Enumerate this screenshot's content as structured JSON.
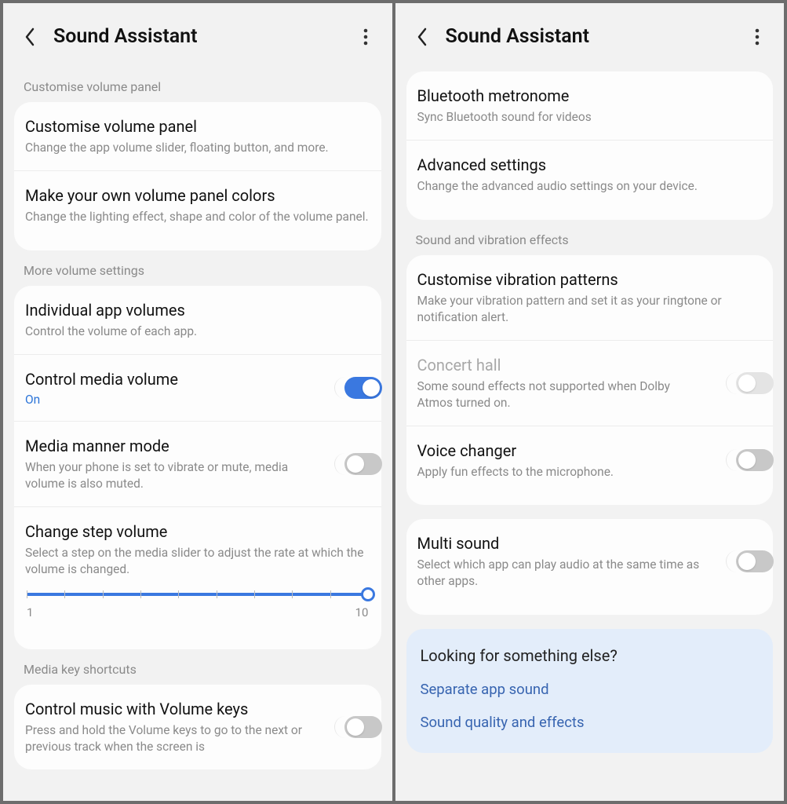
{
  "left": {
    "title": "Sound Assistant",
    "section1Label": "Customise volume panel",
    "row1": {
      "title": "Customise volume panel",
      "desc": "Change the app volume slider, floating button, and more."
    },
    "row2": {
      "title": "Make your own volume panel colors",
      "desc": "Change the lighting effect, shape and color of the volume panel."
    },
    "section2Label": "More volume settings",
    "row3": {
      "title": "Individual app volumes",
      "desc": "Control the volume of each app."
    },
    "row4": {
      "title": "Control media volume",
      "status": "On"
    },
    "row5": {
      "title": "Media manner mode",
      "desc": "When your phone is set to vibrate or mute, media volume is also muted."
    },
    "row6": {
      "title": "Change step volume",
      "desc": "Select a step on the media slider to adjust the rate at which the volume is changed.",
      "min": "1",
      "max": "10"
    },
    "section3Label": "Media key shortcuts",
    "row7": {
      "title": "Control music with Volume keys",
      "desc": "Press and hold the Volume keys to go to the next or previous track when the screen is"
    }
  },
  "right": {
    "title": "Sound Assistant",
    "row1": {
      "title": "Bluetooth metronome",
      "desc": "Sync Bluetooth sound for videos"
    },
    "row2": {
      "title": "Advanced settings",
      "desc": "Change the advanced audio settings on your device."
    },
    "section2Label": "Sound and vibration effects",
    "row3": {
      "title": "Customise vibration patterns",
      "desc": "Make your vibration pattern and set it as your ringtone or notification alert."
    },
    "row4": {
      "title": "Concert hall",
      "desc": "Some sound effects not supported when Dolby Atmos turned on."
    },
    "row5": {
      "title": "Voice changer",
      "desc": "Apply fun effects to the microphone."
    },
    "row6": {
      "title": "Multi sound",
      "desc": "Select which app can play audio at the same time as other apps."
    },
    "suggest": {
      "title": "Looking for something else?",
      "link1": "Separate app sound",
      "link2": "Sound quality and effects"
    }
  }
}
